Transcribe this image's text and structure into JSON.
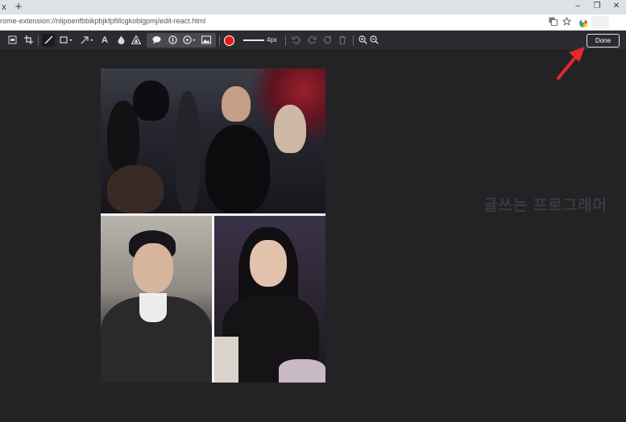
{
  "browser": {
    "tab_close": "x",
    "new_tab": "+",
    "window": {
      "minimize": "–",
      "restore": "❐",
      "close": "✕"
    },
    "url": "rome-extension://nlipoenfbbikpbjkfpfillcgkoblgpmj/edit-react.html"
  },
  "toolbar": {
    "stroke_size": "4px",
    "done_label": "Done",
    "text_tool": "A",
    "color": "#e41a1a"
  },
  "canvas": {
    "watermark": "글쓰는 프로그래머"
  },
  "icons": [
    "screen-capture-icon",
    "crop-icon",
    "pen-icon",
    "rectangle-icon",
    "arrow-icon",
    "text-icon",
    "blur-icon",
    "mosaic-icon",
    "speech-bubble-icon",
    "number-icon",
    "stamp-icon",
    "image-icon",
    "undo-icon",
    "redo-icon",
    "reset-icon",
    "trash-icon",
    "zoom-in-icon",
    "zoom-out-icon"
  ]
}
